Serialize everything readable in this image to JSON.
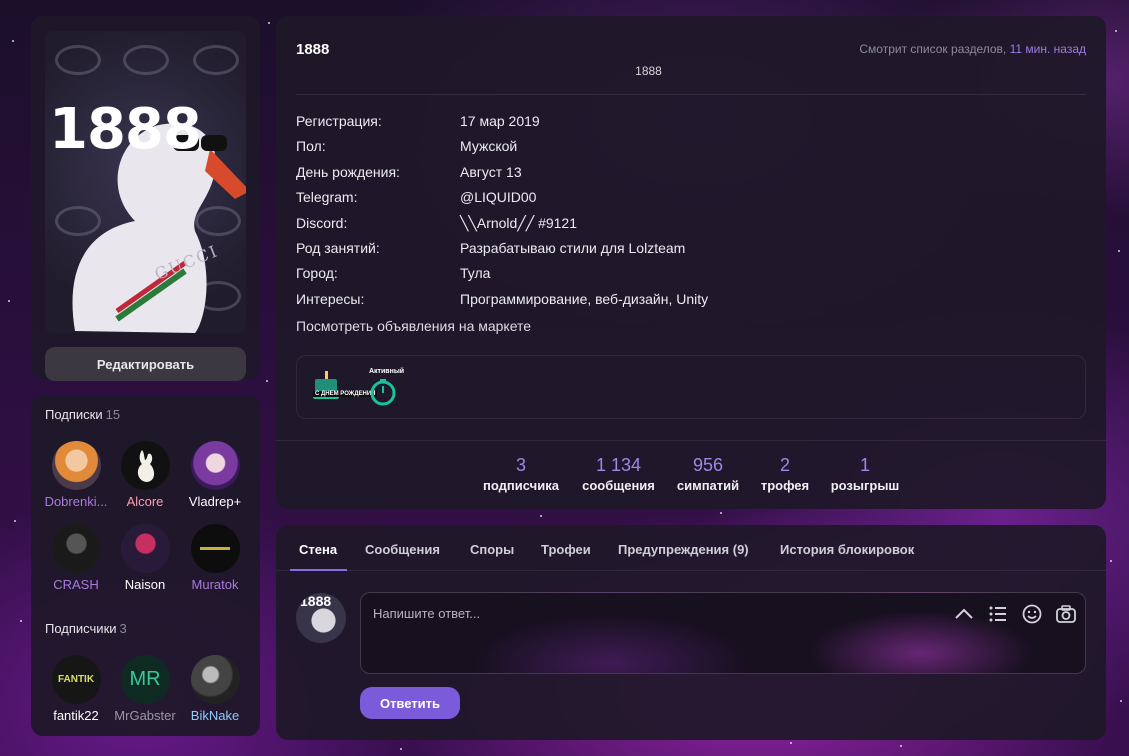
{
  "profile": {
    "username": "1888",
    "subtitle": "1888",
    "avatar_text": "1888",
    "avatar_brand_text": "GUCCI",
    "edit_label": "Редактировать",
    "activity": {
      "text": "Смотрит список разделов,",
      "time": "11 мин. назад"
    }
  },
  "info": {
    "rows": [
      {
        "label": "Регистрация:",
        "value": "17 мар 2019"
      },
      {
        "label": "Пол:",
        "value": "Мужской"
      },
      {
        "label": "День рождения:",
        "value": "Август 13"
      },
      {
        "label": "Telegram:",
        "value": "@LIQUID00"
      },
      {
        "label": "Discord:",
        "value": "╲╲Arnold╱╱ #9121"
      },
      {
        "label": "Род занятий:",
        "value": "Разрабатываю стили для Lolzteam"
      },
      {
        "label": "Город:",
        "value": "Тула"
      },
      {
        "label": "Интересы:",
        "value": "Программирование, веб-дизайн, Unity"
      }
    ],
    "market_link": "Посмотреть объявления на маркете"
  },
  "trophies": [
    {
      "icon": "birthday-cake-trophy-icon",
      "text": "С ДНЕМ РОЖДЕНИЯ"
    },
    {
      "icon": "active-stopwatch-trophy-icon",
      "text": "Активный"
    }
  ],
  "stats": [
    {
      "num": "3",
      "label": "подписчика"
    },
    {
      "num": "1 134",
      "label": "сообщения"
    },
    {
      "num": "956",
      "label": "симпатий"
    },
    {
      "num": "2",
      "label": "трофея"
    },
    {
      "num": "1",
      "label": "розыгрыш"
    }
  ],
  "following": {
    "title": "Подписки",
    "count": "15",
    "users": [
      {
        "name": "Dobrenki...",
        "color": "#a77bdc"
      },
      {
        "name": "Alcore",
        "color": "#ff9eae"
      },
      {
        "name": "Vladrep+",
        "color": "#ffffff"
      },
      {
        "name": "CRASH",
        "color": "#a77bdc"
      },
      {
        "name": "Naison",
        "color": "#ffffff"
      },
      {
        "name": "Muratok",
        "color": "#a77bdc"
      }
    ]
  },
  "followers": {
    "title": "Подписчики",
    "count": "3",
    "users": [
      {
        "name": "fantik22",
        "color": "#ffffff",
        "avatar_text": "FANTIK"
      },
      {
        "name": "MrGabster",
        "color": "#9a97a3",
        "avatar_text": "MR"
      },
      {
        "name": "BikNake",
        "color": "#8ecbff"
      }
    ]
  },
  "tabs": [
    "Стена",
    "Сообщения",
    "Споры",
    "Трофеи",
    "Предупреждения (9)",
    "История блокировок"
  ],
  "reply": {
    "placeholder": "Напишите ответ...",
    "submit": "Ответить",
    "avatar_text": "1888"
  }
}
